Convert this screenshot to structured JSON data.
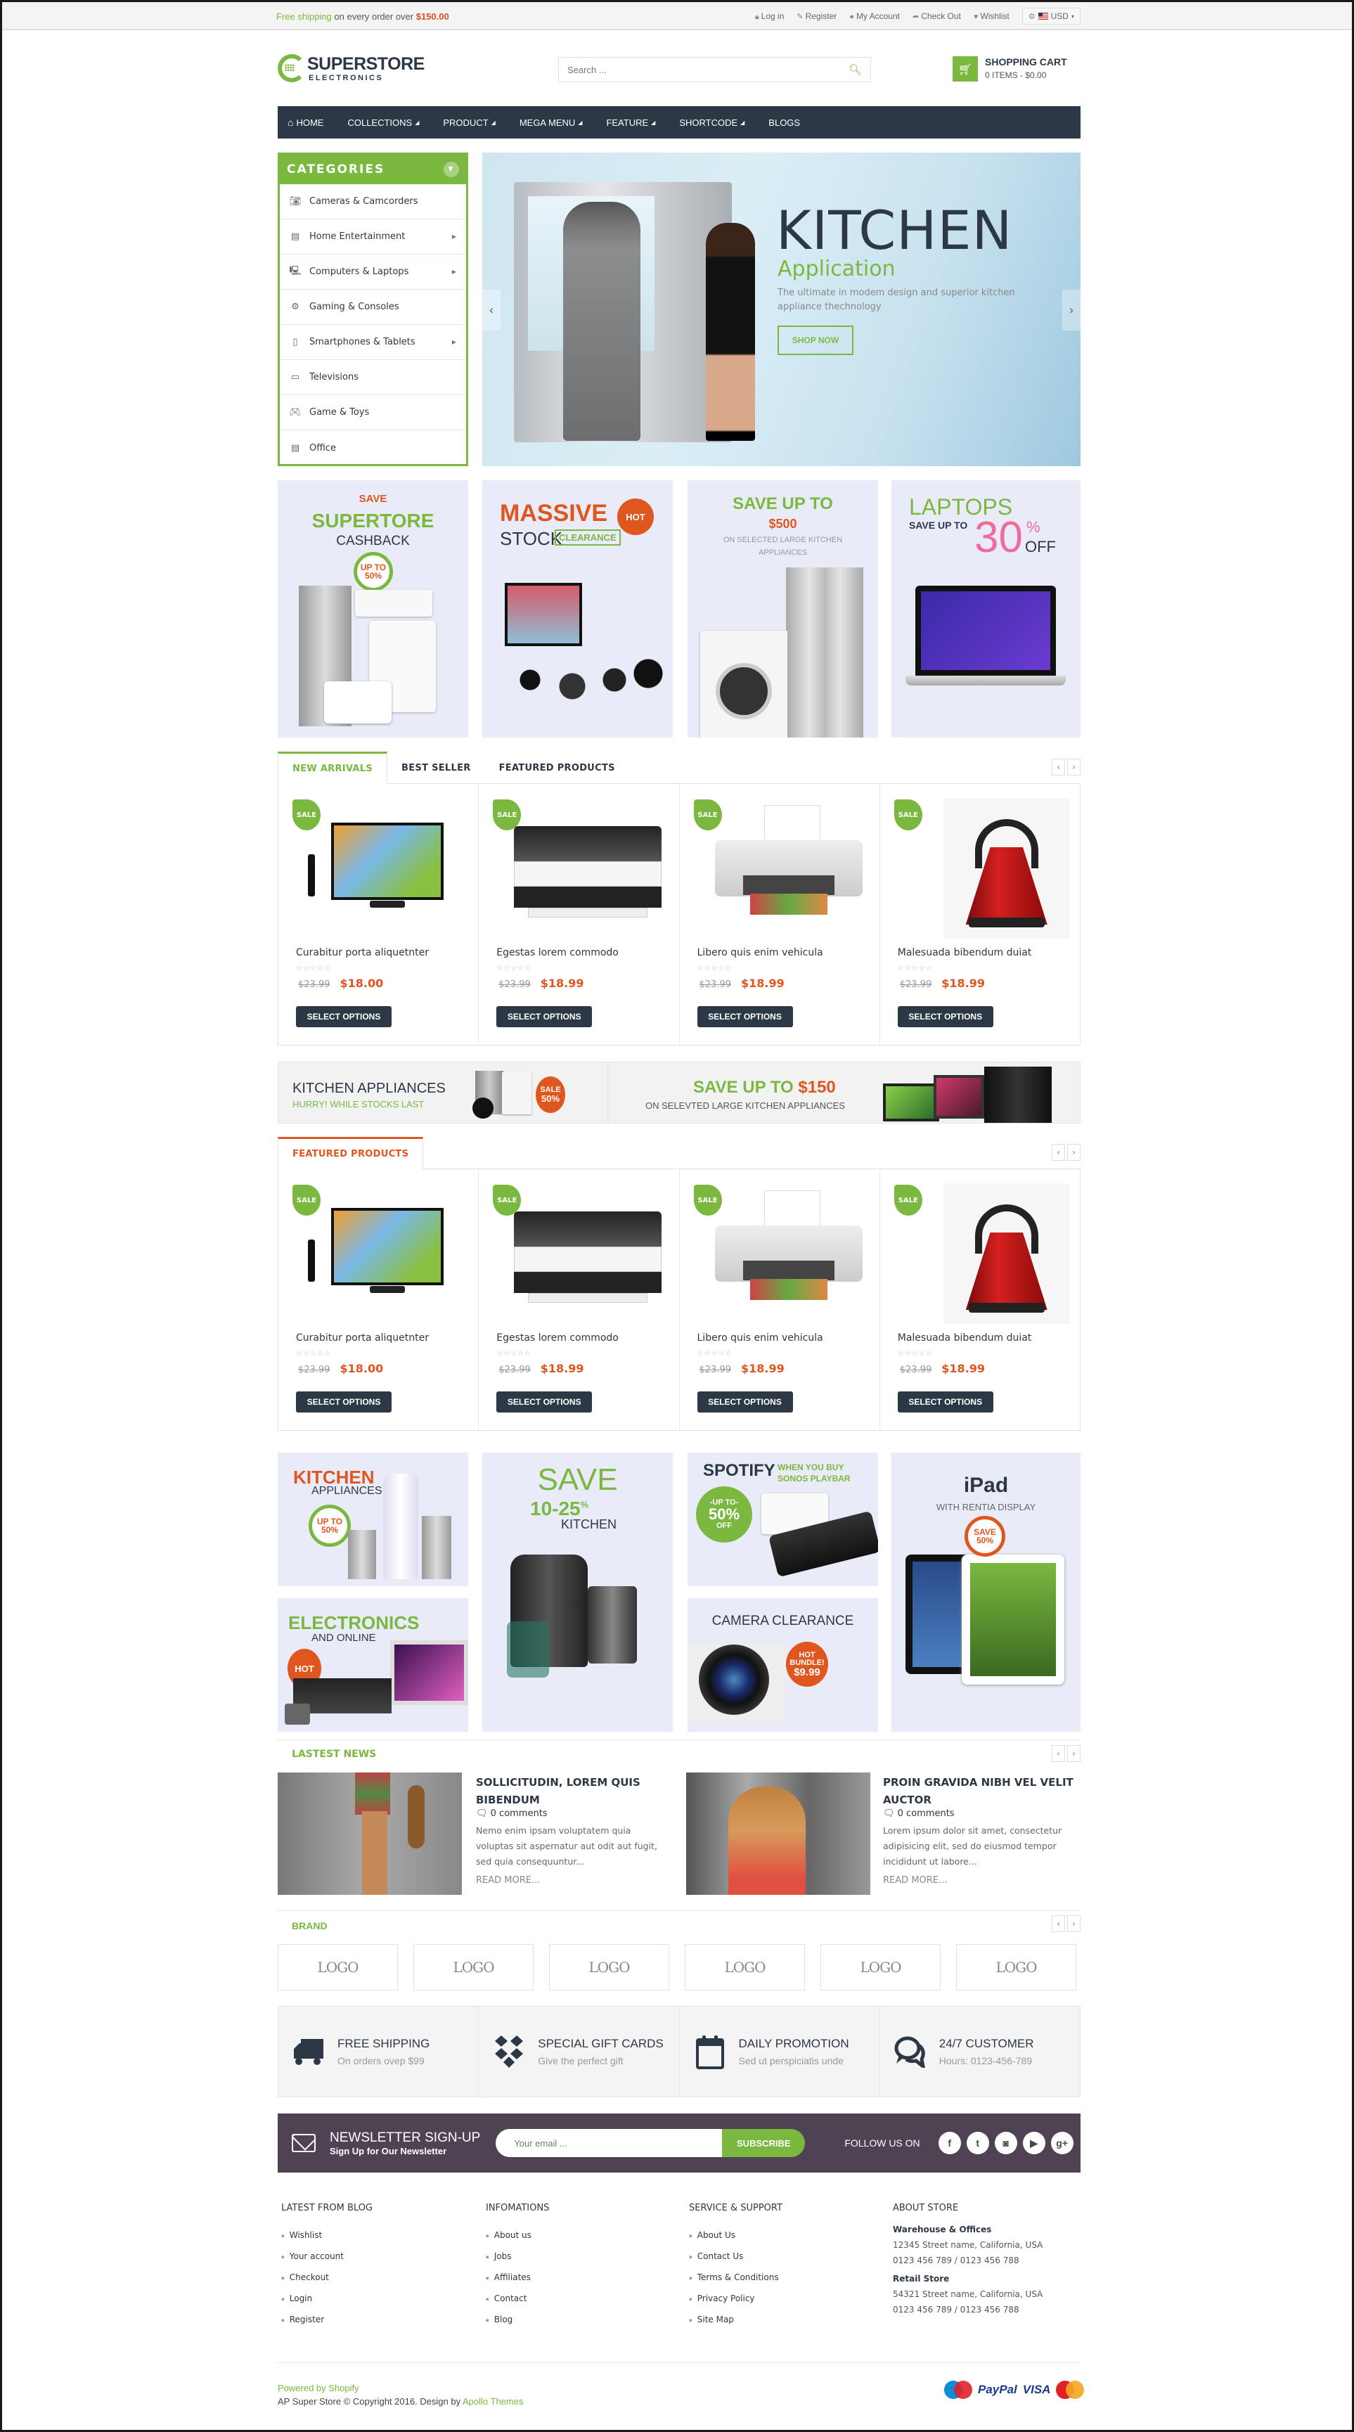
{
  "topbar": {
    "shipping_prefix": "Free shipping",
    "shipping_middle": " on every order over ",
    "shipping_amount": "$150.00",
    "links": [
      {
        "icon": "lock-icon",
        "label": "Log in"
      },
      {
        "icon": "edit-icon",
        "label": "Register"
      },
      {
        "icon": "user-icon",
        "label": "My Account"
      },
      {
        "icon": "share-icon",
        "label": "Check Out"
      },
      {
        "icon": "heart-icon",
        "label": "Wishlist"
      }
    ],
    "currency": "USD"
  },
  "header": {
    "logo_title": "SUPERSTORE",
    "logo_subtitle": "ELECTRONICS",
    "search_placeholder": "Search ...",
    "cart_title": "SHOPPING CART",
    "cart_summary": "0 ITEMS - $0.00"
  },
  "nav": {
    "items": [
      {
        "label": "HOME",
        "dropdown": false
      },
      {
        "label": "COLLECTIONS",
        "dropdown": true
      },
      {
        "label": "PRODUCT",
        "dropdown": true
      },
      {
        "label": "MEGA MENU",
        "dropdown": true
      },
      {
        "label": "FEATURE",
        "dropdown": true
      },
      {
        "label": "SHORTCODE",
        "dropdown": true
      },
      {
        "label": "BLOGS",
        "dropdown": false
      }
    ]
  },
  "categories": {
    "title": "CATEGORIES",
    "items": [
      {
        "label": "Cameras & Camcorders",
        "icon": "camera-icon",
        "submenu": false
      },
      {
        "label": "Home Entertainment",
        "icon": "film-icon",
        "submenu": true
      },
      {
        "label": "Computers & Laptops",
        "icon": "desktop-icon",
        "submenu": true
      },
      {
        "label": "Gaming & Consoles",
        "icon": "gear-icon",
        "submenu": false
      },
      {
        "label": "Smartphones & Tablets",
        "icon": "tablet-icon",
        "submenu": true
      },
      {
        "label": "Televisions",
        "icon": "tv-icon",
        "submenu": false
      },
      {
        "label": "Game & Toys",
        "icon": "gamepad-icon",
        "submenu": false
      },
      {
        "label": "Office",
        "icon": "printer-icon",
        "submenu": false
      }
    ]
  },
  "slider": {
    "title": "KITCHEN",
    "subtitle": "Application",
    "description": "The ultimate in modem design and superior kitchen appliance thechnology",
    "button": "SHOP NOW"
  },
  "promo_banners": [
    {
      "line1": "SAVE",
      "line2": "SUPERTORE",
      "line3": "CASHBACK",
      "badge": "UP TO 50%"
    },
    {
      "line1": "MASSIVE",
      "line2": "STOCK",
      "line3": "CLEARANCE",
      "badge": "HOT"
    },
    {
      "line1": "SAVE UP TO",
      "line2": "$500",
      "line3": "ON SELECTED LARGE KITCHEN APPLIANCES"
    },
    {
      "line1": "LAPTOPS",
      "line2": "SAVE UP TO",
      "line3": "30",
      "line4": "%",
      "line5": "OFF"
    }
  ],
  "product_tabs": {
    "tabs": [
      "NEW ARRIVALS",
      "BEST SELLER",
      "FEATURED PRODUCTS"
    ],
    "active": 0
  },
  "products": [
    {
      "name": "Curabitur porta aliquetnter",
      "old_price": "$23.99",
      "price": "$18.00",
      "badge": "SALE",
      "rating": 0,
      "button": "SELECT OPTIONS",
      "kind": "tv"
    },
    {
      "name": "Egestas lorem commodo",
      "old_price": "$23.99",
      "price": "$18.99",
      "badge": "SALE",
      "rating": 0,
      "button": "SELECT OPTIONS",
      "kind": "printer-large"
    },
    {
      "name": "Libero quis enim vehicula",
      "old_price": "$23.99",
      "price": "$18.99",
      "badge": "SALE",
      "rating": 0,
      "button": "SELECT OPTIONS",
      "kind": "printer-small"
    },
    {
      "name": "Malesuada bibendum duiat",
      "old_price": "$23.99",
      "price": "$18.99",
      "badge": "SALE",
      "rating": 0,
      "button": "SELECT OPTIONS",
      "kind": "kettle"
    }
  ],
  "wide_banners": {
    "left_title": "KITCHEN APPLIANCES",
    "left_sub": "HURRY! WHILE STOCKS LAST",
    "left_badge_1": "SALE",
    "left_badge_2": "50%",
    "right_title_a": "SAVE UP TO ",
    "right_title_b": "$150",
    "right_sub": "ON SELEVTED LARGE KITCHEN APPLIANCES"
  },
  "featured": {
    "tab": "FEATURED PRODUCTS"
  },
  "grid_banners": {
    "kitchen": {
      "t1": "KITCHEN",
      "t2": "APPLIANCES",
      "badge": "UP TO 50%"
    },
    "save": {
      "t1": "SAVE",
      "t2": "10-25",
      "t3": "%",
      "t4": "KITCHEN"
    },
    "spotify": {
      "t1": "SPOTIFY",
      "t2": "WHEN YOU BUY",
      "t3": "SONOS PLAYBAR",
      "b1": "-UP TO-",
      "b2": "50%",
      "b3": "OFF"
    },
    "ipad": {
      "t1": "iPad",
      "t2": "WITH RENTIA DISPLAY",
      "badge1": "SAVE",
      "badge2": "50%"
    },
    "electronics": {
      "t1": "ELECTRONICS",
      "t2": "AND ONLINE",
      "badge": "HOT"
    },
    "camera": {
      "t1": "CAMERA CLEARANCE",
      "b1": "HOT",
      "b2": "BUNDLE!",
      "b3": "$9.99"
    }
  },
  "news": {
    "title": "LASTEST NEWS",
    "items": [
      {
        "title": "SOLLICITUDIN, LOREM QUIS BIBENDUM",
        "comments": "0 comments",
        "excerpt": "Nemo enim ipsam voluptatem quia voluptas sit aspernatur aut odit aut fugit, sed quia consequuntur...",
        "more": "READ MORE..."
      },
      {
        "title": "PROIN GRAVIDA NIBH VEL VELIT AUCTOR",
        "comments": "0 comments",
        "excerpt": "Lorem ipsum dolor sit amet, consectetur adipisicing elit, sed do eiusmod tempor incididunt ut labore...",
        "more": "READ MORE..."
      }
    ]
  },
  "brand": {
    "title": "BRAND",
    "logos": [
      "LOGO",
      "LOGO",
      "LOGO",
      "LOGO",
      "LOGO",
      "LOGO"
    ]
  },
  "features": [
    {
      "icon": "truck-icon",
      "title": "FREE SHIPPING",
      "sub": "On orders ovep $99"
    },
    {
      "icon": "gift-card-icon",
      "title": "SPECIAL GIFT CARDS",
      "sub": "Give the perfect gift"
    },
    {
      "icon": "calendar-icon",
      "title": "DAILY PROMOTION",
      "sub": "Sed ut perspiciatis unde"
    },
    {
      "icon": "chat-icon",
      "title": "24/7 CUSTOMER",
      "sub": "Hours: 0123-456-789"
    }
  ],
  "newsletter": {
    "title": "NEWSLETTER SIGN-UP",
    "subtitle": "Sign Up for Our Newsletter",
    "placeholder": "Your email ...",
    "button": "SUBSCRIBE",
    "follow": "FOLLOW US ON",
    "social": [
      {
        "name": "facebook",
        "glyph": "f"
      },
      {
        "name": "twitter",
        "glyph": "t"
      },
      {
        "name": "instagram",
        "glyph": "◙"
      },
      {
        "name": "youtube",
        "glyph": "▶"
      },
      {
        "name": "google-plus",
        "glyph": "g+"
      }
    ]
  },
  "footer": {
    "columns": [
      {
        "title": "LATEST FROM BLOG",
        "links": [
          "Wishlist",
          "Your account",
          "Checkout",
          "Login",
          "Register"
        ]
      },
      {
        "title": "INFOMATIONS",
        "links": [
          "About us",
          "Jobs",
          "Affiliates",
          "Contact",
          "Blog"
        ]
      },
      {
        "title": "SERVICE & SUPPORT",
        "links": [
          "About Us",
          "Contact Us",
          "Terms & Conditions",
          "Privacy Policy",
          "Site Map"
        ]
      }
    ],
    "about": {
      "title": "ABOUT STORE",
      "blocks": [
        {
          "heading": "Warehouse & Offices",
          "address": "12345 Street name, California, USA",
          "phone": "0123 456 789 / 0123 456 788"
        },
        {
          "heading": "Retail Store",
          "address": "54321 Street name, California, USA",
          "phone": "0123 456 789 / 0123 456 788"
        }
      ]
    },
    "powered": "Powered by Shopify",
    "copyright_prefix": "AP Super Store © Copyright 2016. Design by ",
    "copyright_link": "Apollo Themes",
    "payments": [
      "Maestro",
      "PayPal",
      "VISA",
      "MasterCard"
    ]
  },
  "colors": {
    "accent": "#7bb83f",
    "dark": "#2d3846",
    "sale_red": "#e0561f",
    "newsletter_bg": "#4f4353",
    "banner_bg": "#e9ecf8"
  }
}
